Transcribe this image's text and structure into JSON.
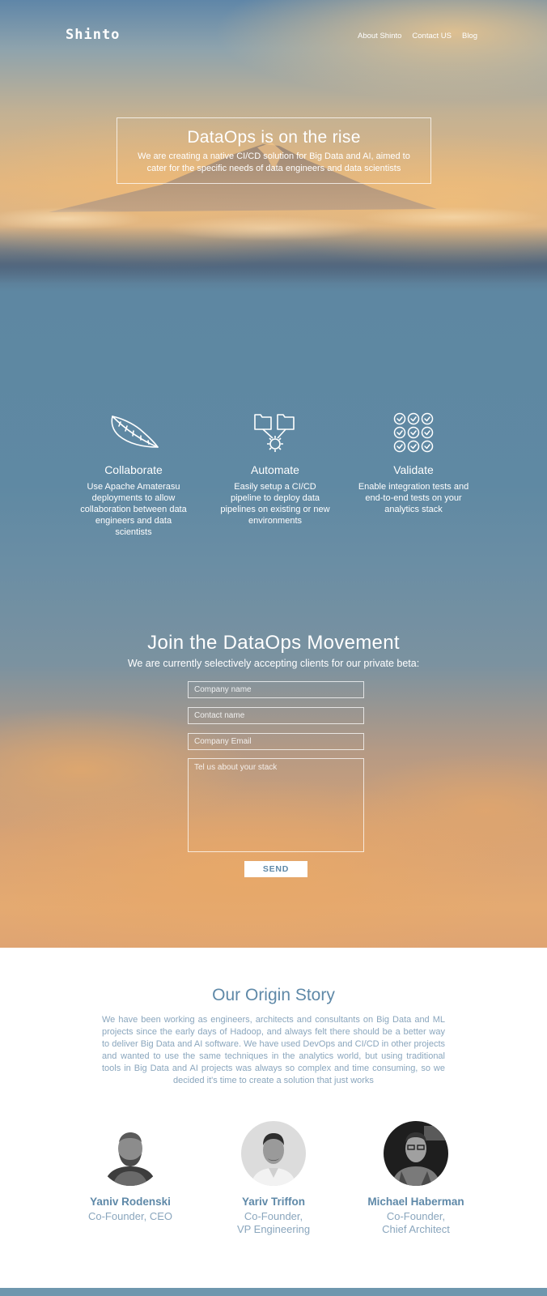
{
  "nav": {
    "logo": "Shinto",
    "links": [
      "About Shinto",
      "Contact US",
      "Blog"
    ]
  },
  "hero": {
    "title": "DataOps is on the rise",
    "subtitle": "We are creating a native CI/CD solution for Big Data and AI, aimed to cater for the specific needs of data engineers and data scientists"
  },
  "features": [
    {
      "icon": "feather-icon",
      "title": "Collaborate",
      "text": "Use Apache Amaterasu deployments to allow collaboration between data engineers and data scientists"
    },
    {
      "icon": "folders-gear-icon",
      "title": "Automate",
      "text": "Easily setup a CI/CD pipeline to deploy data pipelines on existing or new environments"
    },
    {
      "icon": "check-grid-icon",
      "title": "Validate",
      "text": "Enable integration tests and end-to-end tests on your analytics stack"
    }
  ],
  "join": {
    "title": "Join the DataOps Movement",
    "subtitle": "We are currently selectively accepting clients for our private beta:",
    "company_name_placeholder": "Company name",
    "contact_name_placeholder": "Contact name",
    "email_placeholder": "Company Email",
    "stack_placeholder": "Tel us about your stack",
    "send_label": "SEND"
  },
  "origin": {
    "title": "Our Origin Story",
    "text": "We have been working as engineers, architects and consultants on Big Data and ML projects since the early days of Hadoop, and always felt there should be a better way to deliver Big Data and AI software. We have used DevOps and CI/CD in other projects and wanted to use the same techniques in the analytics world, but using traditional tools in Big Data and AI projects was always so complex and time consuming, so we decided it's time to create a solution that just works"
  },
  "team": [
    {
      "name": "Yaniv Rodenski",
      "role_line1": "Co-Founder, CEO",
      "role_line2": ""
    },
    {
      "name": "Yariv Triffon",
      "role_line1": "Co-Founder,",
      "role_line2": "VP Engineering"
    },
    {
      "name": "Michael Haberman",
      "role_line1": "Co-Founder,",
      "role_line2": "Chief Architect"
    }
  ],
  "colors": {
    "accent": "#5f89a8",
    "muted_text": "#8aa6bd",
    "footer_bar": "#6f97ae"
  }
}
